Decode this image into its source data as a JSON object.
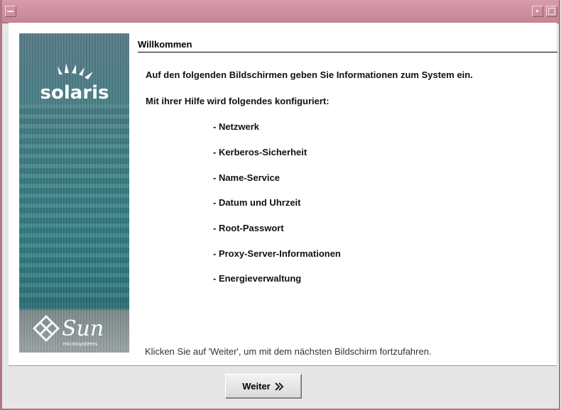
{
  "window": {
    "title": ""
  },
  "sidebar": {
    "product_logo_text": "solaris",
    "vendor_logo_text": "Sun",
    "vendor_logo_subtext": "microsystems"
  },
  "page": {
    "title": "Willkommen",
    "intro": "Auf den folgenden Bildschirmen geben Sie Informationen zum System ein.",
    "configured_label": "Mit ihrer Hilfe wird folgendes konfiguriert:",
    "items": [
      "- Netzwerk",
      "- Kerberos-Sicherheit",
      "- Name-Service",
      "- Datum und Uhrzeit",
      "- Root-Passwort",
      "- Proxy-Server-Informationen",
      "- Energieverwaltung"
    ],
    "footer_hint": "Klicken Sie auf 'Weiter', um mit dem nächsten Bildschirm fortzufahren."
  },
  "buttons": {
    "next_label": "Weiter"
  },
  "colors": {
    "titlebar": "#cd8d9e",
    "sidebar_teal": "#2f7d83",
    "accent_window_border": "#b07886"
  }
}
